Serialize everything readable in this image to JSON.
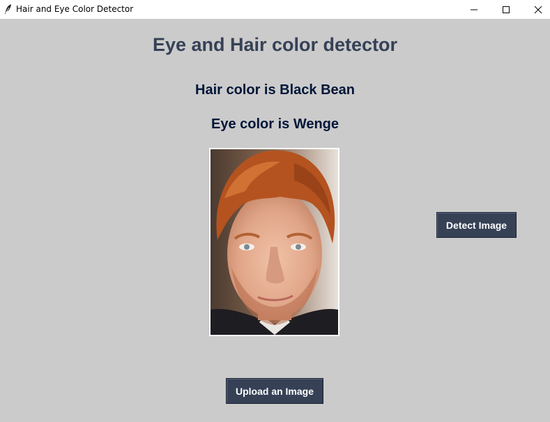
{
  "window": {
    "title": "Hair and Eye Color Detector",
    "icon": "feather-icon",
    "controls": [
      "minimize-icon",
      "maximize-icon",
      "close-icon"
    ]
  },
  "main": {
    "heading": "Eye and Hair color detector",
    "hair_result": "Hair color is Black Bean",
    "eye_result": "Eye color is Wenge",
    "detect_button_label": "Detect Image",
    "upload_button_label": "Upload an Image"
  },
  "colors": {
    "background": "#cbcbcb",
    "heading": "#364156",
    "result_text": "#011638",
    "button_bg": "#364156",
    "button_text": "#ffffff"
  }
}
